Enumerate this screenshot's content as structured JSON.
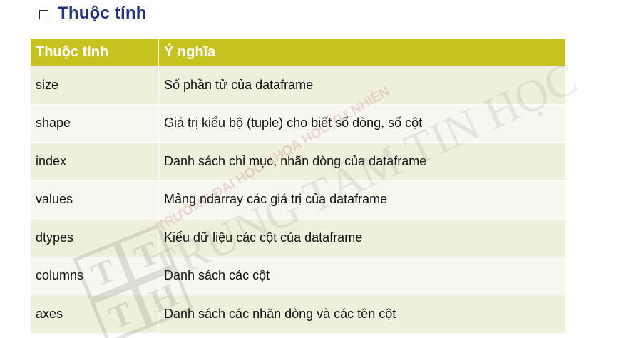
{
  "heading": {
    "text": "Thuộc tính"
  },
  "table": {
    "headers": [
      "Thuộc tính",
      "Ý nghĩa"
    ],
    "rows": [
      {
        "attr": "size",
        "meaning": "Số phần tử của dataframe"
      },
      {
        "attr": "shape",
        "meaning": "Giá trị kiểu bộ (tuple) cho biết số dòng, số cột"
      },
      {
        "attr": "index",
        "meaning": "Danh sách chỉ mục, nhãn dòng của dataframe"
      },
      {
        "attr": "values",
        "meaning": "Mảng ndarray các giá trị của dataframe"
      },
      {
        "attr": "dtypes",
        "meaning": "Kiểu dữ liệu các cột của dataframe"
      },
      {
        "attr": "columns",
        "meaning": "Danh sách các cột"
      },
      {
        "attr": "axes",
        "meaning": "Danh sách các nhãn dòng và các tên cột"
      }
    ]
  },
  "watermark": {
    "line1": "TRƯỜNG ĐẠI HỌC KHOA HỌC TỰ NHIÊN",
    "line2": "TRUNG TÂM TIN HỌC",
    "logo_letters": "TT TH"
  },
  "colors": {
    "header_bg": "#c6c320",
    "row_bg": "#e9eacf",
    "row_alt_bg": "#f3f4e7",
    "heading_color": "#1f3288"
  }
}
